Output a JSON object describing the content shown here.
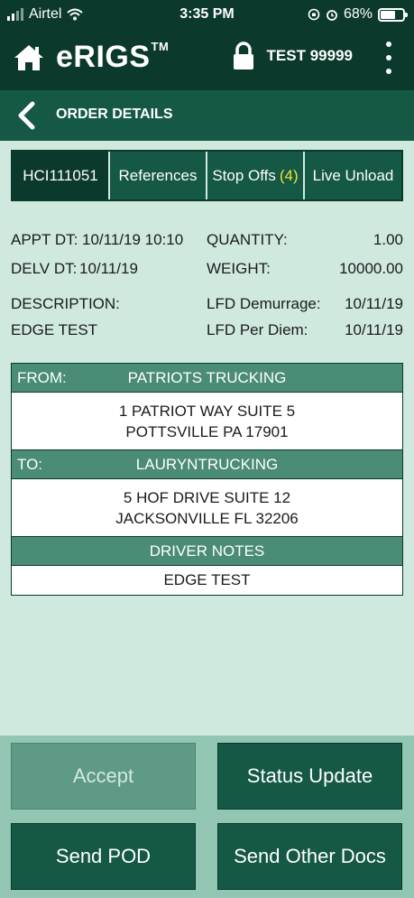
{
  "status_bar": {
    "carrier": "Airtel",
    "time": "3:35 PM",
    "battery": "68%",
    "battery_level": 0.68
  },
  "app": {
    "brand": "eRIGS",
    "tm": "TM",
    "user": "TEST 99999"
  },
  "subheader": {
    "title": "ORDER DETAILS"
  },
  "tabs": [
    {
      "label": "HCI111051"
    },
    {
      "label": "References"
    },
    {
      "label": "Stop Offs",
      "count": "(4)"
    },
    {
      "label": "Live Unload"
    }
  ],
  "details": {
    "appt_dt_label": "APPT DT:",
    "appt_dt": "10/11/19 10:10",
    "quantity_label": "QUANTITY:",
    "quantity": "1.00",
    "delv_dt_label": "DELV DT:",
    "delv_dt": "10/11/19",
    "weight_label": "WEIGHT:",
    "weight": "10000.00",
    "description_label": "DESCRIPTION:",
    "description": "EDGE TEST",
    "lfd_demurrage_label": "LFD Demurrage:",
    "lfd_demurrage": "10/11/19",
    "lfd_per_diem_label": "LFD Per Diem:",
    "lfd_per_diem": "10/11/19"
  },
  "from": {
    "label": "FROM:",
    "name": "PATRIOTS TRUCKING",
    "line1": "1 PATRIOT WAY SUITE 5",
    "line2": "POTTSVILLE PA 17901"
  },
  "to": {
    "label": "TO:",
    "name": "LAURYNTRUCKING",
    "line1": "5 HOF DRIVE SUITE 12",
    "line2": "JACKSONVILLE FL 32206"
  },
  "driver_notes": {
    "title": "DRIVER NOTES",
    "text": "EDGE TEST"
  },
  "buttons": {
    "accept": "Accept",
    "status_update": "Status Update",
    "send_pod": "Send POD",
    "send_other_docs": "Send Other Docs"
  },
  "colors": {
    "dark": "#0b3a2c",
    "mid": "#145845",
    "header_row": "#4a8c75",
    "background": "#cfe9df",
    "badge": "#e6e830"
  }
}
